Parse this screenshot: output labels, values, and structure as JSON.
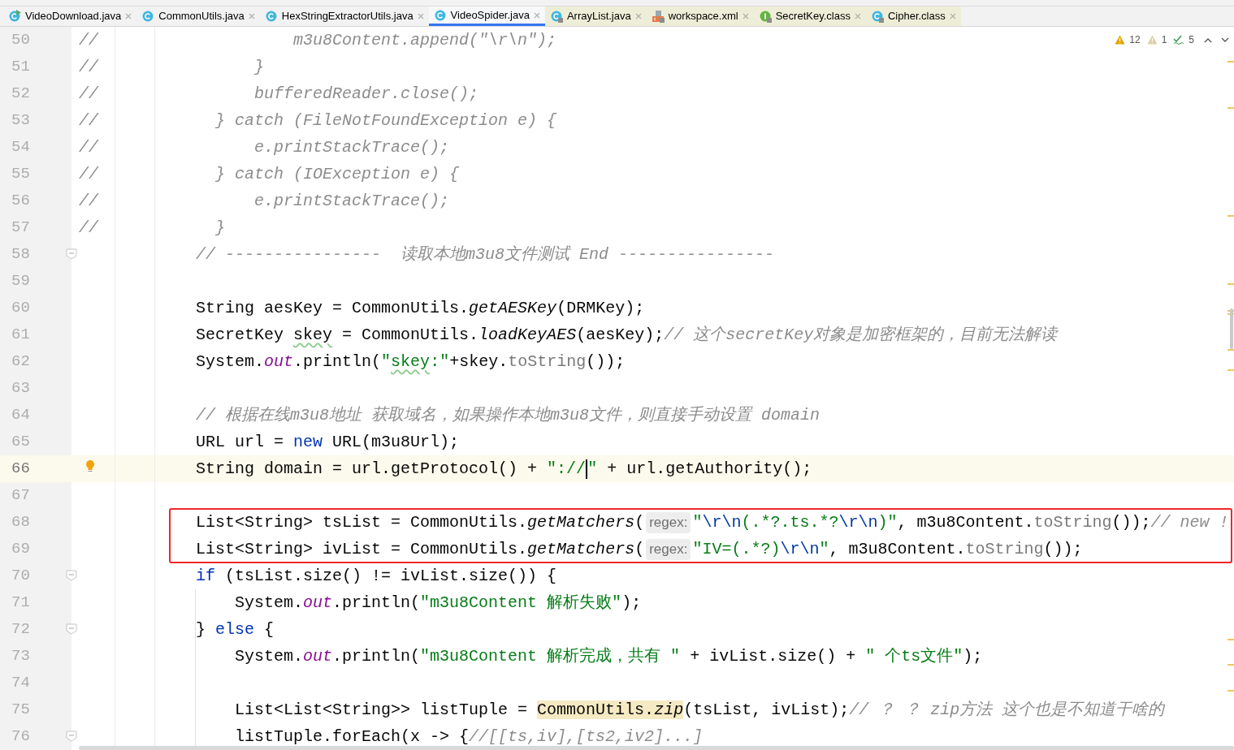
{
  "tabs": [
    {
      "label": "VideoDownload.java",
      "kind": "class-run",
      "library": false,
      "selected": false
    },
    {
      "label": "CommonUtils.java",
      "kind": "class",
      "library": false,
      "selected": false
    },
    {
      "label": "HexStringExtractorUtils.java",
      "kind": "class",
      "library": false,
      "selected": false
    },
    {
      "label": "VideoSpider.java",
      "kind": "class",
      "library": false,
      "selected": true
    },
    {
      "label": "ArrayList.java",
      "kind": "class",
      "library": true,
      "selected": false
    },
    {
      "label": "workspace.xml",
      "kind": "xml",
      "library": true,
      "selected": false
    },
    {
      "label": "SecretKey.class",
      "kind": "interface",
      "library": true,
      "selected": false
    },
    {
      "label": "Cipher.class",
      "kind": "class",
      "library": true,
      "selected": false
    }
  ],
  "inspections": [
    {
      "kind": "warning",
      "count": "12"
    },
    {
      "kind": "weak-warning",
      "count": "1"
    },
    {
      "kind": "typo",
      "count": "5"
    }
  ],
  "lines": [
    {
      "number": "50",
      "current": false,
      "tokens": [
        {
          "kind": "comment",
          "text": "//                    m3u8Content.append(\"\\r\\n\");"
        }
      ]
    },
    {
      "number": "51",
      "current": false,
      "tokens": [
        {
          "kind": "comment",
          "text": "//                }"
        }
      ]
    },
    {
      "number": "52",
      "current": false,
      "tokens": [
        {
          "kind": "comment",
          "text": "//                bufferedReader.close();"
        }
      ]
    },
    {
      "number": "53",
      "current": false,
      "tokens": [
        {
          "kind": "comment",
          "text": "//            } catch (FileNotFoundException e) {"
        }
      ]
    },
    {
      "number": "54",
      "current": false,
      "tokens": [
        {
          "kind": "comment",
          "text": "//                e.printStackTrace();"
        }
      ]
    },
    {
      "number": "55",
      "current": false,
      "tokens": [
        {
          "kind": "comment",
          "text": "//            } catch (IOException e) {"
        }
      ]
    },
    {
      "number": "56",
      "current": false,
      "tokens": [
        {
          "kind": "comment",
          "text": "//                e.printStackTrace();"
        }
      ]
    },
    {
      "number": "57",
      "current": false,
      "tokens": [
        {
          "kind": "comment",
          "text": "//            }"
        }
      ]
    },
    {
      "number": "58",
      "current": false,
      "kind": "fold",
      "tokens": [
        {
          "kind": "comment",
          "text": "            // ----------------  读取本地m3u8文件测试 End ----------------"
        }
      ]
    },
    {
      "number": "59",
      "current": false
    },
    {
      "number": "60",
      "current": false,
      "tokens": [
        {
          "kind": "plain",
          "text": "            String aesKey = CommonUtils."
        },
        {
          "kind": "static",
          "text": "getAESKey"
        },
        {
          "kind": "plain",
          "text": "(DRMKey);"
        }
      ]
    },
    {
      "number": "61",
      "current": false,
      "tokens": [
        {
          "kind": "plain",
          "text": "            SecretKey "
        },
        {
          "kind": "typo",
          "text": "skey"
        },
        {
          "kind": "plain",
          "text": " = CommonUtils."
        },
        {
          "kind": "static",
          "text": "loadKeyAES"
        },
        {
          "kind": "plain",
          "text": "(aesKey);"
        },
        {
          "kind": "comment",
          "text": "// 这个secretKey对象是加密框架的，目前无法解读"
        }
      ]
    },
    {
      "number": "62",
      "current": false,
      "tokens": [
        {
          "kind": "plain",
          "text": "            System."
        },
        {
          "kind": "field",
          "text": "out"
        },
        {
          "kind": "plain",
          "text": ".println("
        },
        {
          "kind": "string",
          "text": "\""
        },
        {
          "kind": "string-typo",
          "text": "skey"
        },
        {
          "kind": "string",
          "text": ":\""
        },
        {
          "kind": "plain",
          "text": "+skey."
        },
        {
          "kind": "dim",
          "text": "toString"
        },
        {
          "kind": "plain",
          "text": "());"
        }
      ]
    },
    {
      "number": "63",
      "current": false
    },
    {
      "number": "64",
      "current": false,
      "tokens": [
        {
          "kind": "comment",
          "text": "            // 根据在线m3u8地址 获取域名，如果操作本地m3u8文件，则直接手动设置 domain"
        }
      ]
    },
    {
      "number": "65",
      "current": false,
      "tokens": [
        {
          "kind": "plain",
          "text": "            URL url = "
        },
        {
          "kind": "keyword",
          "text": "new"
        },
        {
          "kind": "plain",
          "text": " URL(m3u8Url);"
        }
      ]
    },
    {
      "number": "66",
      "current": true,
      "kind": "bulb",
      "tokens": [
        {
          "kind": "plain",
          "text": "            String domain = url.getProtocol() + "
        },
        {
          "kind": "string",
          "text": "\"://"
        },
        {
          "kind": "caret"
        },
        {
          "kind": "string",
          "text": "\""
        },
        {
          "kind": "plain",
          "text": " + url.getAuthority();"
        }
      ]
    },
    {
      "number": "67",
      "current": false
    },
    {
      "kind": "box",
      "lines": [
        {
          "number": "68",
          "current": false,
          "tokens": [
            {
              "kind": "plain",
              "text": "            List<String> tsList = CommonUtils."
            },
            {
              "kind": "static",
              "text": "getMatchers"
            },
            {
              "kind": "plain",
              "text": "("
            },
            {
              "kind": "hint",
              "text": "regex:"
            },
            {
              "kind": "string",
              "text": "\""
            },
            {
              "kind": "escape",
              "text": "\\r\\n"
            },
            {
              "kind": "string",
              "text": "(.*?.ts.*?"
            },
            {
              "kind": "escape",
              "text": "\\r\\n"
            },
            {
              "kind": "string",
              "text": ")\""
            },
            {
              "kind": "plain",
              "text": ", m3u8Content."
            },
            {
              "kind": "dim",
              "text": "toString"
            },
            {
              "kind": "plain",
              "text": "());"
            },
            {
              "kind": "comment",
              "text": "// new !"
            }
          ]
        },
        {
          "number": "69",
          "current": false,
          "tokens": [
            {
              "kind": "plain",
              "text": "            List<String> ivList = CommonUtils."
            },
            {
              "kind": "static",
              "text": "getMatchers"
            },
            {
              "kind": "plain",
              "text": "("
            },
            {
              "kind": "hint",
              "text": "regex:"
            },
            {
              "kind": "string",
              "text": "\"IV=(.*?)"
            },
            {
              "kind": "escape",
              "text": "\\r\\n"
            },
            {
              "kind": "string",
              "text": "\""
            },
            {
              "kind": "plain",
              "text": ", m3u8Content."
            },
            {
              "kind": "dim",
              "text": "toString"
            },
            {
              "kind": "plain",
              "text": "());"
            }
          ]
        }
      ]
    },
    {
      "number": "70",
      "current": false,
      "kind": "fold",
      "tokens": [
        {
          "kind": "keyword",
          "text": "            if"
        },
        {
          "kind": "plain",
          "text": " (tsList.size() != ivList.size()) {"
        }
      ]
    },
    {
      "number": "71",
      "current": false,
      "tokens": [
        {
          "kind": "plain",
          "text": "                System."
        },
        {
          "kind": "field",
          "text": "out"
        },
        {
          "kind": "plain",
          "text": ".println("
        },
        {
          "kind": "string",
          "text": "\"m3u8Content 解析失败\""
        },
        {
          "kind": "plain",
          "text": ");"
        }
      ]
    },
    {
      "number": "72",
      "current": false,
      "kind": "fold",
      "tokens": [
        {
          "kind": "plain",
          "text": "            } "
        },
        {
          "kind": "keyword",
          "text": "else"
        },
        {
          "kind": "plain",
          "text": " {"
        }
      ]
    },
    {
      "number": "73",
      "current": false,
      "tokens": [
        {
          "kind": "plain",
          "text": "                System."
        },
        {
          "kind": "field",
          "text": "out"
        },
        {
          "kind": "plain",
          "text": ".println("
        },
        {
          "kind": "string",
          "text": "\"m3u8Content 解析完成，共有 \""
        },
        {
          "kind": "plain",
          "text": " + ivList.size() + "
        },
        {
          "kind": "string",
          "text": "\" 个ts文件\""
        },
        {
          "kind": "plain",
          "text": ");"
        }
      ]
    },
    {
      "number": "74",
      "current": false
    },
    {
      "number": "75",
      "current": false,
      "tokens": [
        {
          "kind": "plain",
          "text": "                List<List<String>> listTuple = "
        },
        {
          "kind": "highlight",
          "text": "CommonUtils."
        },
        {
          "kind": "highlight-static",
          "text": "zip"
        },
        {
          "kind": "plain",
          "text": "(tsList, ivList);"
        },
        {
          "kind": "comment",
          "text": "// ？ ？ zip方法 这个也是不知道干啥的"
        }
      ]
    },
    {
      "number": "76",
      "current": false,
      "kind": "fold",
      "tokens": [
        {
          "kind": "plain",
          "text": "                listTuple.forEach(x -> {"
        },
        {
          "kind": "comment",
          "text": "//[[ts,iv],[ts2,iv2]...]"
        }
      ]
    }
  ]
}
